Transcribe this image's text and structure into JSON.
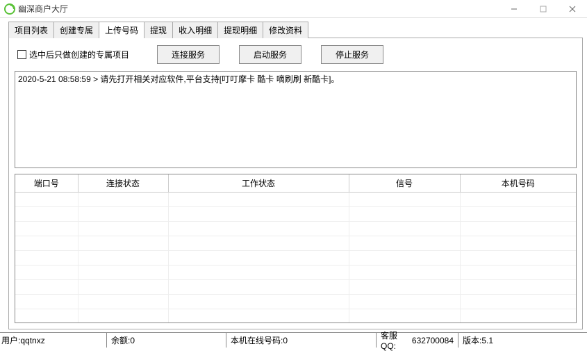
{
  "window": {
    "title": "幽深商户大厅"
  },
  "tabs": [
    {
      "label": "项目列表"
    },
    {
      "label": "创建专属"
    },
    {
      "label": "上传号码"
    },
    {
      "label": "提现"
    },
    {
      "label": "收入明细"
    },
    {
      "label": "提现明细"
    },
    {
      "label": "修改资料"
    }
  ],
  "active_tab_index": 2,
  "toolbar": {
    "checkbox_label": "选中后只做创建的专属项目",
    "connect_btn": "连接服务",
    "start_btn": "启动服务",
    "stop_btn": "停止服务"
  },
  "log": {
    "text": "2020-5-21 08:58:59 > 请先打开相关对应软件,平台支持[叮叮摩卡 酷卡 嘀刷刷 新酷卡]。"
  },
  "table": {
    "headers": [
      "端口号",
      "连接状态",
      "工作状态",
      "信号",
      "本机号码"
    ],
    "rows": []
  },
  "statusbar": {
    "user_label": "用户:",
    "user_value": "qqtnxz",
    "balance_label": "余额:",
    "balance_value": "0",
    "online_label": "本机在线号码:",
    "online_value": "0",
    "service_label": "客服QQ:",
    "service_value": "632700084",
    "version_label": "版本:",
    "version_value": "5.1"
  }
}
